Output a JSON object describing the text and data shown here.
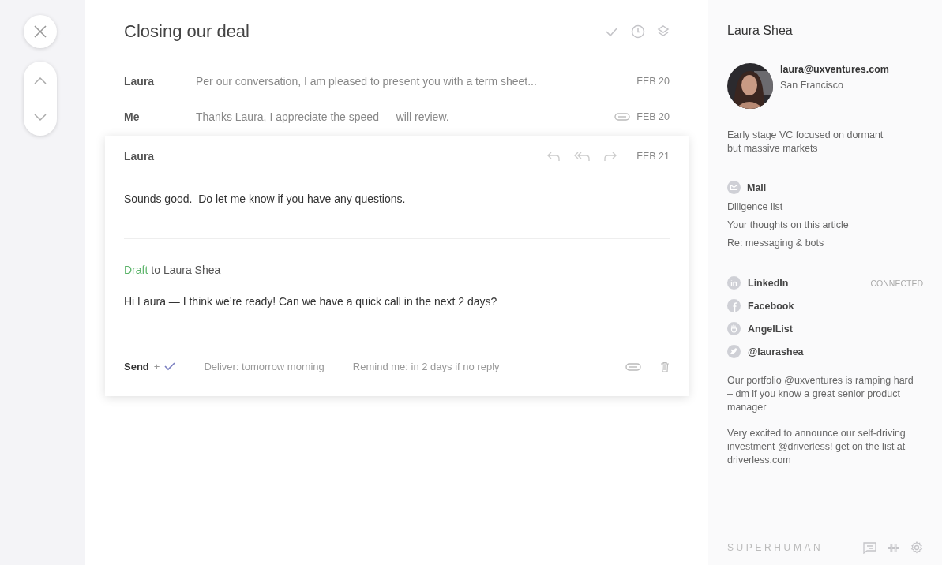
{
  "subject": "Closing our deal",
  "thread": [
    {
      "sender": "Laura",
      "snippet": "Per our conversation, I am pleased to present you with a term sheet...",
      "date": "FEB 20",
      "attachment": false
    },
    {
      "sender": "Me",
      "snippet": "Thanks Laura, I appreciate the speed — will review.",
      "date": "FEB 20",
      "attachment": true
    }
  ],
  "open_message": {
    "sender": "Laura",
    "date": "FEB 21",
    "body": "Sounds good.  Do let me know if you have any questions."
  },
  "draft": {
    "label": "Draft",
    "recipient": "to Laura Shea",
    "body": "Hi Laura — I think we’re ready! Can we have a quick call in the next 2 days?",
    "send": "Send",
    "send_plus": "+",
    "deliver": "Deliver: tomorrow morning",
    "remind": "Remind me: in 2 days if no reply"
  },
  "contact": {
    "name": "Laura Shea",
    "email": "laura@uxventures.com",
    "location": "San Francisco",
    "bio": "Early stage VC focused on dormant but massive markets",
    "mail_heading": "Mail",
    "mail_items": [
      "Diligence list",
      "Your thoughts on this article",
      "Re: messaging & bots"
    ],
    "social": [
      {
        "kind": "linkedin",
        "label": "LinkedIn",
        "status": "CONNECTED"
      },
      {
        "kind": "facebook",
        "label": "Facebook"
      },
      {
        "kind": "angellist",
        "label": "AngelList"
      },
      {
        "kind": "twitter",
        "label": "@laurashea"
      }
    ],
    "posts": [
      "Our portfolio @uxventures is ramping hard – dm if you know a great senior product manager",
      "Very excited to announce our self-driving investment @driverless! get on the list at driverless.com"
    ]
  },
  "brand": "SUPERHUMAN"
}
